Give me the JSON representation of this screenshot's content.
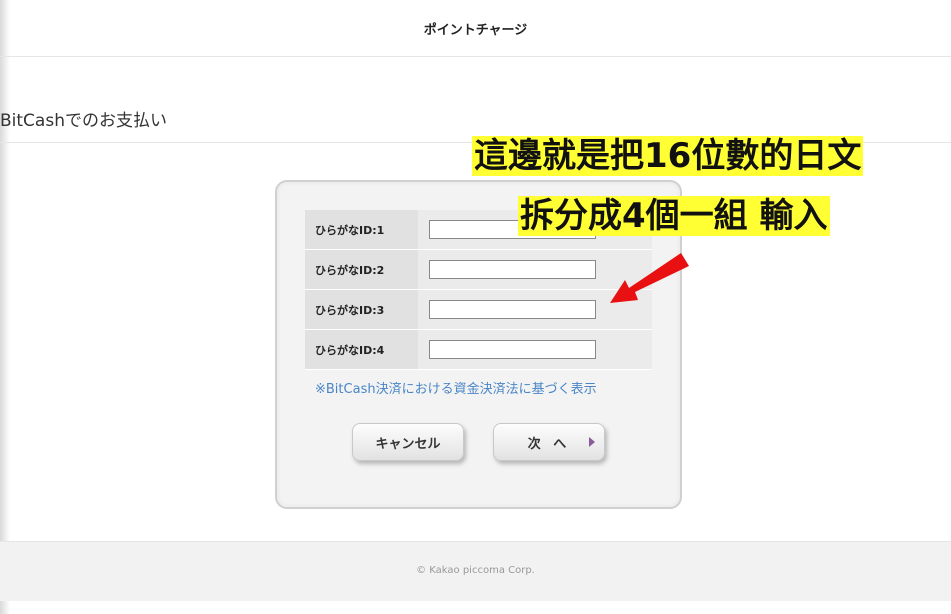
{
  "header": {
    "title": "ポイントチャージ"
  },
  "section": {
    "title": "BitCashでのお支払い"
  },
  "form": {
    "rows": [
      {
        "label": "ひらがなID:1",
        "value": ""
      },
      {
        "label": "ひらがなID:2",
        "value": ""
      },
      {
        "label": "ひらがなID:3",
        "value": ""
      },
      {
        "label": "ひらがなID:4",
        "value": ""
      }
    ],
    "notice": "※BitCash決済における資金決済法に基づく表示",
    "cancel_label": "キャンセル",
    "next_label": "次 へ"
  },
  "annotation": {
    "line1": "這邊就是把16位數的日文",
    "line2": "拆分成4個一組 輸入",
    "arrow_color": "#e81010",
    "highlight_color": "#ffff33"
  },
  "footer": {
    "copyright": "© Kakao piccoma Corp."
  },
  "colors": {
    "link": "#4a86c6",
    "next_arrow": "#8a5a9a"
  }
}
